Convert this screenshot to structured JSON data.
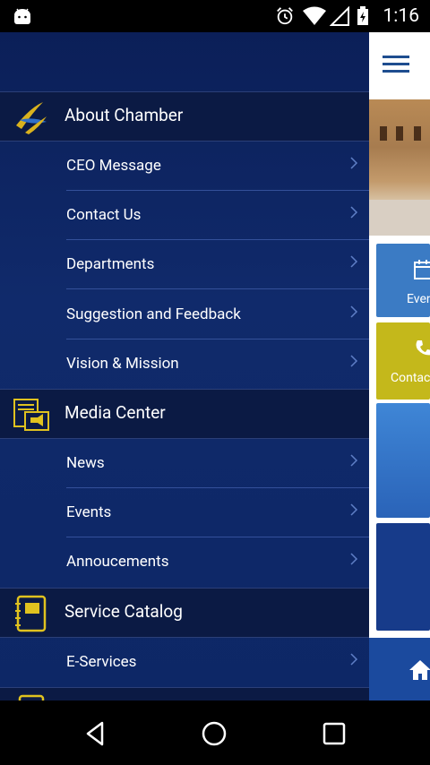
{
  "status_bar": {
    "time": "1:16",
    "icons": [
      "android-icon",
      "alarm-icon",
      "wifi-icon",
      "signal-icon",
      "battery-icon"
    ]
  },
  "drawer": {
    "sections": [
      {
        "title": "About Chamber",
        "icon": "chamber-logo-icon",
        "items": [
          "CEO Message",
          "Contact Us",
          "Departments",
          "Suggestion and Feedback",
          "Vision & Mission"
        ]
      },
      {
        "title": "Media Center",
        "icon": "media-center-icon",
        "items": [
          "News",
          "Events",
          "Annoucements"
        ]
      },
      {
        "title": "Service Catalog",
        "icon": "notebook-icon",
        "items": [
          "E-Services"
        ]
      }
    ]
  },
  "app": {
    "tiles": [
      "Events",
      "Contact"
    ],
    "menu_icon": "hamburger-icon",
    "home_icon": "home-icon"
  },
  "colors": {
    "drawer_bg": "#0d2766",
    "section_bg": "#0b1a44",
    "accent_yellow": "#c4b81b",
    "accent_blue": "#3b7bc4"
  },
  "nav_bar": [
    "back-icon",
    "home-circle-icon",
    "recents-icon"
  ]
}
